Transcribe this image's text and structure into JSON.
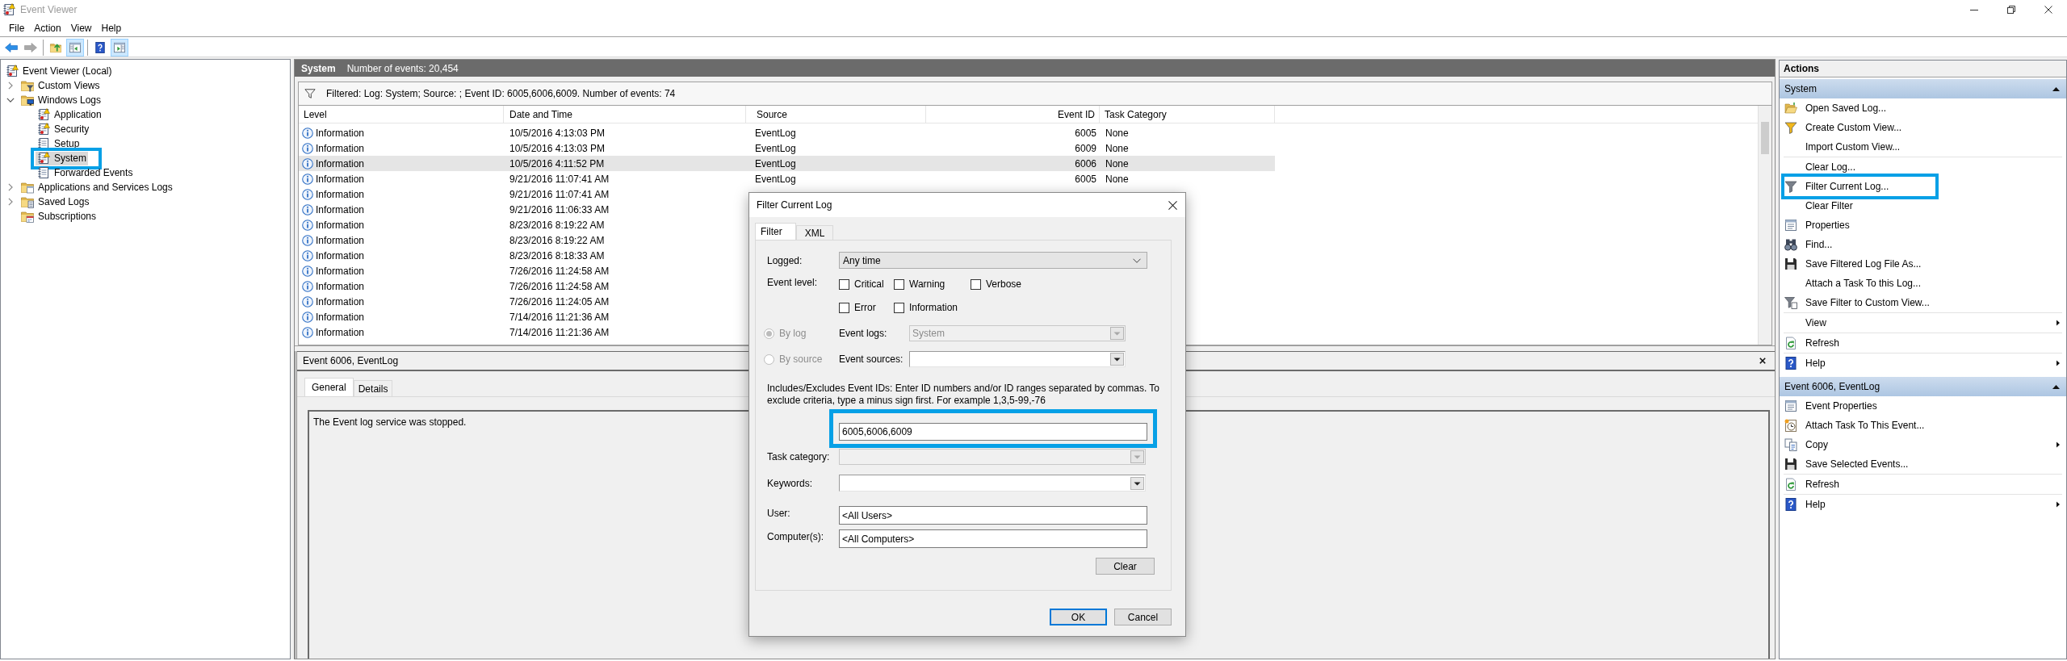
{
  "window": {
    "title": "Event Viewer"
  },
  "menu": [
    {
      "label": "File"
    },
    {
      "label": "Action"
    },
    {
      "label": "View"
    },
    {
      "label": "Help"
    }
  ],
  "toolbar": [
    {
      "buttons": [
        {
          "pressed": false,
          "disabled": false
        },
        {
          "pressed": false,
          "disabled": true
        }
      ]
    },
    {
      "buttons": [
        {
          "pressed": false,
          "disabled": false
        },
        {
          "pressed": true,
          "disabled": false
        }
      ]
    },
    {
      "buttons": [
        {
          "pressed": false,
          "disabled": false
        },
        {
          "pressed": true,
          "disabled": false
        }
      ]
    }
  ],
  "tree": {
    "items": [
      {
        "label": "Event Viewer (Local)",
        "selected": false,
        "annotated": false,
        "children": [
          {
            "label": "Custom Views",
            "expanded": false,
            "selected": false,
            "annotated": false
          },
          {
            "label": "Windows Logs",
            "expanded": true,
            "selected": false,
            "annotated": false,
            "children": [
              {
                "label": "Application",
                "selected": false,
                "annotated": false
              },
              {
                "label": "Security",
                "selected": false,
                "annotated": false
              },
              {
                "label": "Setup",
                "selected": false,
                "annotated": false
              },
              {
                "label": "System",
                "selected": true,
                "annotated": true
              },
              {
                "label": "Forwarded Events",
                "selected": false,
                "annotated": false
              }
            ]
          },
          {
            "label": "Applications and Services Logs",
            "expanded": false,
            "selected": false,
            "annotated": false
          },
          {
            "label": "Saved Logs",
            "expanded": false,
            "selected": false,
            "annotated": false
          },
          {
            "label": "Subscriptions",
            "selected": false,
            "annotated": false
          }
        ]
      }
    ]
  },
  "log_view": {
    "title": "System",
    "event_count": "Number of events: 20,454",
    "filter_summary": "Filtered: Log: System; Source: ; Event ID: 6005,6006,6009. Number of events: 74",
    "table": {
      "columns": [
        {
          "label": "Level"
        },
        {
          "label": "Date and Time"
        },
        {
          "label": "Source"
        },
        {
          "label": "Event ID"
        },
        {
          "label": "Task Category"
        }
      ],
      "rows": [
        {
          "level": "Information",
          "date_time": "10/5/2016 4:13:03 PM",
          "source": "EventLog",
          "event_id": "6005",
          "task_category": "None",
          "selected": false
        },
        {
          "level": "Information",
          "date_time": "10/5/2016 4:13:03 PM",
          "source": "EventLog",
          "event_id": "6009",
          "task_category": "None",
          "selected": false
        },
        {
          "level": "Information",
          "date_time": "10/5/2016 4:11:52 PM",
          "source": "EventLog",
          "event_id": "6006",
          "task_category": "None",
          "selected": true
        },
        {
          "level": "Information",
          "date_time": "9/21/2016 11:07:41 AM",
          "source": "EventLog",
          "event_id": "6005",
          "task_category": "None",
          "selected": false
        },
        {
          "level": "Information",
          "date_time": "9/21/2016 11:07:41 AM",
          "selected": false
        },
        {
          "level": "Information",
          "date_time": "9/21/2016 11:06:33 AM",
          "selected": false
        },
        {
          "level": "Information",
          "date_time": "8/23/2016 8:19:22 AM",
          "selected": false
        },
        {
          "level": "Information",
          "date_time": "8/23/2016 8:19:22 AM",
          "selected": false
        },
        {
          "level": "Information",
          "date_time": "8/23/2016 8:18:33 AM",
          "selected": false
        },
        {
          "level": "Information",
          "date_time": "7/26/2016 11:24:58 AM",
          "selected": false
        },
        {
          "level": "Information",
          "date_time": "7/26/2016 11:24:58 AM",
          "selected": false
        },
        {
          "level": "Information",
          "date_time": "7/26/2016 11:24:05 AM",
          "selected": false
        },
        {
          "level": "Information",
          "date_time": "7/14/2016 11:21:36 AM",
          "selected": false
        },
        {
          "level": "Information",
          "date_time": "7/14/2016 11:21:36 AM",
          "selected": false
        }
      ]
    }
  },
  "event_details": {
    "title": "Event 6006, EventLog",
    "tabs": [
      {
        "label": "General",
        "selected": true
      },
      {
        "label": "Details",
        "selected": false
      }
    ],
    "message": "The Event log service was stopped."
  },
  "actions": {
    "title": "Actions",
    "sections": [
      {
        "title": "System",
        "expanded": true,
        "groups": [
          {
            "items": [
              {
                "label": "Open Saved Log...",
                "submenu": false,
                "annotated": false
              },
              {
                "label": "Create Custom View...",
                "submenu": false,
                "annotated": false
              },
              {
                "label": "Import Custom View...",
                "submenu": false,
                "annotated": false
              }
            ]
          },
          {
            "items": [
              {
                "label": "Clear Log...",
                "submenu": false,
                "annotated": false
              },
              {
                "label": "Filter Current Log...",
                "submenu": false,
                "annotated": true
              },
              {
                "label": "Clear Filter",
                "submenu": false,
                "annotated": false
              },
              {
                "label": "Properties",
                "submenu": false,
                "annotated": false
              },
              {
                "label": "Find...",
                "submenu": false,
                "annotated": false
              },
              {
                "label": "Save Filtered Log File As...",
                "submenu": false,
                "annotated": false
              },
              {
                "label": "Attach a Task To this Log...",
                "submenu": false,
                "annotated": false
              },
              {
                "label": "Save Filter to Custom View...",
                "submenu": false,
                "annotated": false
              }
            ]
          },
          {
            "items": [
              {
                "label": "View",
                "submenu": true,
                "annotated": false
              }
            ]
          },
          {
            "items": [
              {
                "label": "Refresh",
                "submenu": false,
                "annotated": false
              }
            ]
          },
          {
            "items": [
              {
                "label": "Help",
                "submenu": true,
                "annotated": false
              }
            ]
          }
        ]
      },
      {
        "title": "Event 6006, EventLog",
        "expanded": true,
        "groups": [
          {
            "items": [
              {
                "label": "Event Properties",
                "submenu": false,
                "annotated": false
              },
              {
                "label": "Attach Task To This Event...",
                "submenu": false,
                "annotated": false
              },
              {
                "label": "Copy",
                "submenu": true,
                "annotated": false
              },
              {
                "label": "Save Selected Events...",
                "submenu": false,
                "annotated": false
              }
            ]
          },
          {
            "items": [
              {
                "label": "Refresh",
                "submenu": false,
                "annotated": false
              }
            ]
          },
          {
            "items": [
              {
                "label": "Help",
                "submenu": true,
                "annotated": false
              }
            ]
          }
        ]
      }
    ]
  },
  "dialog": {
    "title": "Filter Current Log",
    "tabs": [
      {
        "label": "Filter",
        "selected": true
      },
      {
        "label": "XML",
        "selected": false
      }
    ],
    "logged": {
      "label": "Logged:",
      "value": "Any time"
    },
    "event_level": {
      "label": "Event level:",
      "options": [
        {
          "label": "Critical",
          "checked": false
        },
        {
          "label": "Warning",
          "checked": false
        },
        {
          "label": "Verbose",
          "checked": false
        },
        {
          "label": "Error",
          "checked": false
        },
        {
          "label": "Information",
          "checked": false
        }
      ]
    },
    "scope": [
      {
        "label": "By log",
        "selected": true,
        "disabled": true
      },
      {
        "label": "By source",
        "selected": false,
        "disabled": true
      }
    ],
    "event_logs": {
      "label": "Event logs:",
      "value": "System",
      "disabled": true
    },
    "event_sources": {
      "label": "Event sources:",
      "disabled": false
    },
    "event_ids": {
      "hint": "Includes/Excludes Event IDs: Enter ID numbers and/or ID ranges separated by commas. To exclude criteria, type a minus sign first. For example 1,3,5-99,-76",
      "value": "6005,6006,6009",
      "annotated": true
    },
    "task_category": {
      "label": "Task category:",
      "disabled": true
    },
    "keywords": {
      "label": "Keywords:",
      "disabled": false
    },
    "user": {
      "label": "User:",
      "value": "<All Users>"
    },
    "computers": {
      "label": "Computer(s):",
      "value": "<All Computers>"
    },
    "clear_button": "Clear",
    "buttons": [
      {
        "label": "OK",
        "default": true
      },
      {
        "label": "Cancel",
        "default": false
      }
    ]
  }
}
